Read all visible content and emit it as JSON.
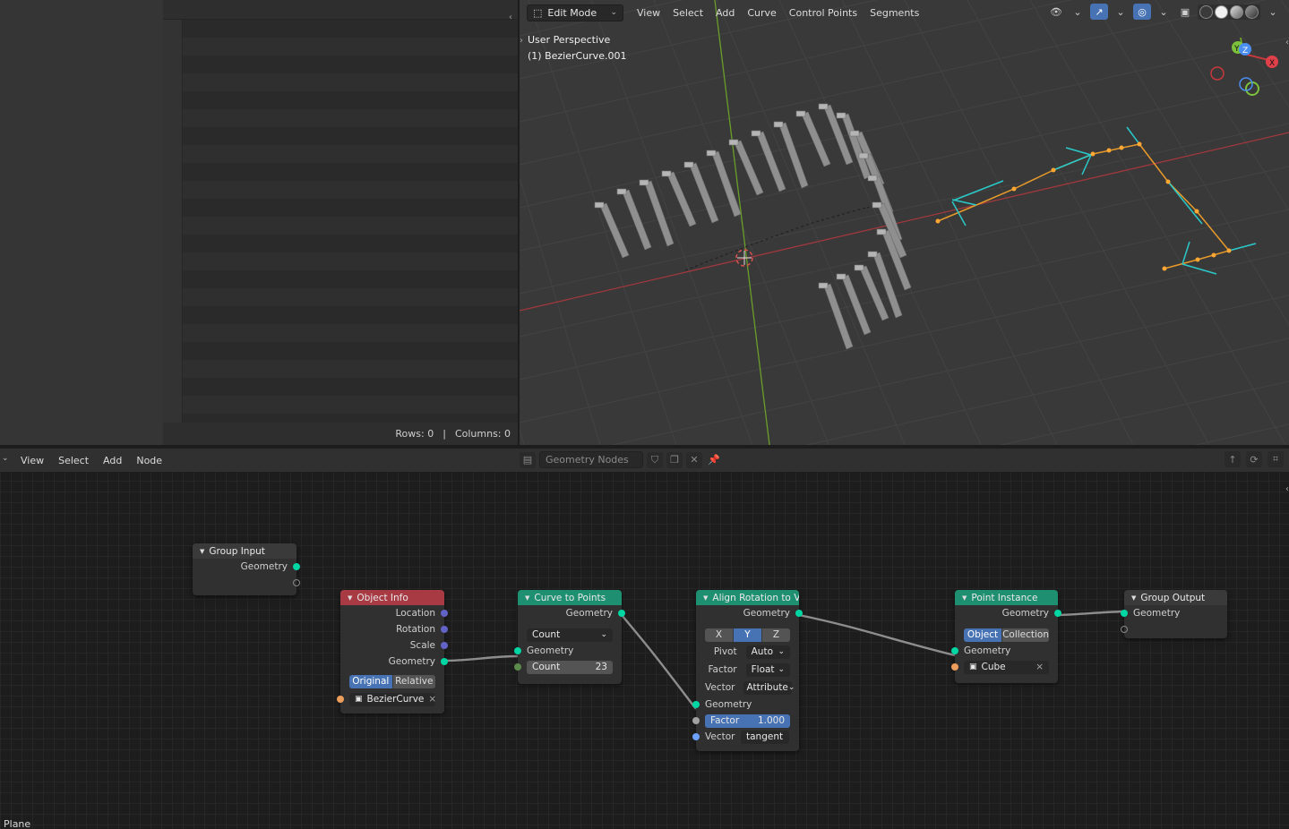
{
  "spreadsheet": {
    "rows_label": "Rows: 0",
    "separator": "|",
    "columns_label": "Columns: 0"
  },
  "viewport": {
    "mode": "Edit Mode",
    "menu": [
      "View",
      "Select",
      "Add",
      "Curve",
      "Control Points",
      "Segments"
    ],
    "overlay_line1": "User Perspective",
    "overlay_line2": "(1) BezierCurve.001",
    "gizmo": {
      "x": "X",
      "y": "Y",
      "z": "Z"
    }
  },
  "node_editor": {
    "menu": [
      "View",
      "Select",
      "Add",
      "Node"
    ],
    "tree_name": "Geometry Nodes",
    "status": "Plane",
    "nodes": {
      "group_input": {
        "title": "Group Input",
        "geometry": "Geometry"
      },
      "object_info": {
        "title": "Object Info",
        "location": "Location",
        "rotation": "Rotation",
        "scale": "Scale",
        "geometry": "Geometry",
        "mode_original": "Original",
        "mode_relative": "Relative",
        "object": "BezierCurve",
        "clear": "×"
      },
      "curve_to_points": {
        "title": "Curve to Points",
        "geometry_out": "Geometry",
        "mode": "Count",
        "geometry_in": "Geometry",
        "count_label": "Count",
        "count_value": "23"
      },
      "align_rotation": {
        "title": "Align Rotation to V...",
        "geometry_out": "Geometry",
        "axis_x": "X",
        "axis_y": "Y",
        "axis_z": "Z",
        "pivot_label": "Pivot",
        "pivot_value": "Auto",
        "factor_label": "Factor",
        "factor_type": "Float",
        "vector_label": "Vector",
        "vector_type": "Attribute",
        "geometry_in": "Geometry",
        "factor_field_label": "Factor",
        "factor_field_value": "1.000",
        "vector_in_label": "Vector",
        "vector_in_value": "tangent"
      },
      "point_instance": {
        "title": "Point Instance",
        "geometry_out": "Geometry",
        "mode_object": "Object",
        "mode_collection": "Collection",
        "geometry_in": "Geometry",
        "object": "Cube",
        "clear": "×"
      },
      "group_output": {
        "title": "Group Output",
        "geometry": "Geometry"
      }
    }
  },
  "colors": {
    "geometry_socket": "#00d6a3",
    "vector_socket": "#6363c7",
    "object_socket": "#ed9e5c",
    "selected_blue": "#4772b3",
    "header_red": "#a83a44",
    "header_teal": "#1f8f72"
  }
}
